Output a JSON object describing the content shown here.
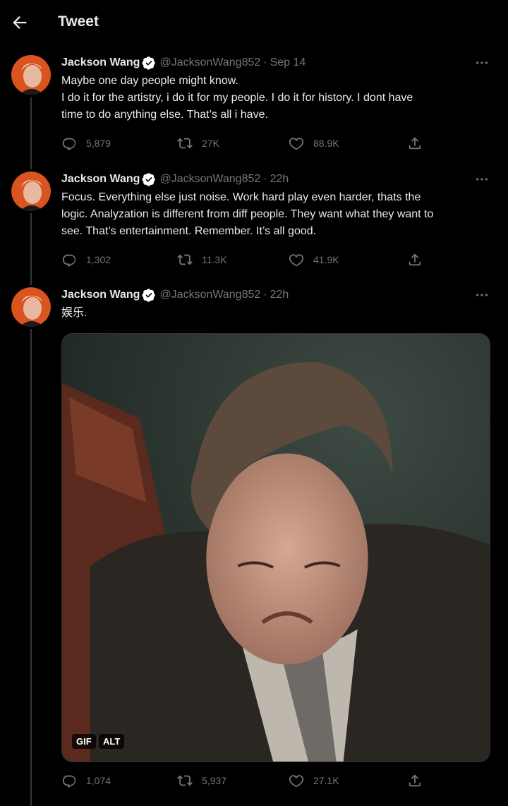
{
  "header": {
    "title": "Tweet"
  },
  "tweets": [
    {
      "name": "Jackson Wang",
      "handle": "@JacksonWang852",
      "dot": "·",
      "time": "Sep 14",
      "lines": [
        "Maybe one day people might know.",
        "I do it for the artistry, i do it for my people. I do it for history. I dont have",
        "time to do anything else. That’s all i have."
      ],
      "replies": "5,879",
      "retweets": "27K",
      "likes": "88.9K"
    },
    {
      "name": "Jackson Wang",
      "handle": "@JacksonWang852",
      "dot": "·",
      "time": "22h",
      "lines": [
        "Focus. Everything else just noise. Work hard play even harder, thats the",
        "logic. Analyzation is different from diff people. They want what they want to",
        "see. That’s entertainment. Remember. It’s all good."
      ],
      "replies": "1,302",
      "retweets": "11.3K",
      "likes": "41.9K"
    },
    {
      "name": "Jackson Wang",
      "handle": "@JacksonWang852",
      "dot": "·",
      "time": "22h",
      "lines": [
        "娱乐."
      ],
      "replies": "1,074",
      "retweets": "5,937",
      "likes": "27.1K",
      "media": {
        "gif_label": "GIF",
        "alt_label": "ALT"
      }
    }
  ],
  "colors": {
    "background": "#000000",
    "text": "#e7e9ea",
    "muted": "#71767b",
    "verified": "#ffffff"
  },
  "icons": [
    "back-arrow-icon",
    "verified-badge-icon",
    "more-dots-icon",
    "reply-icon",
    "retweet-icon",
    "like-icon",
    "share-icon"
  ]
}
